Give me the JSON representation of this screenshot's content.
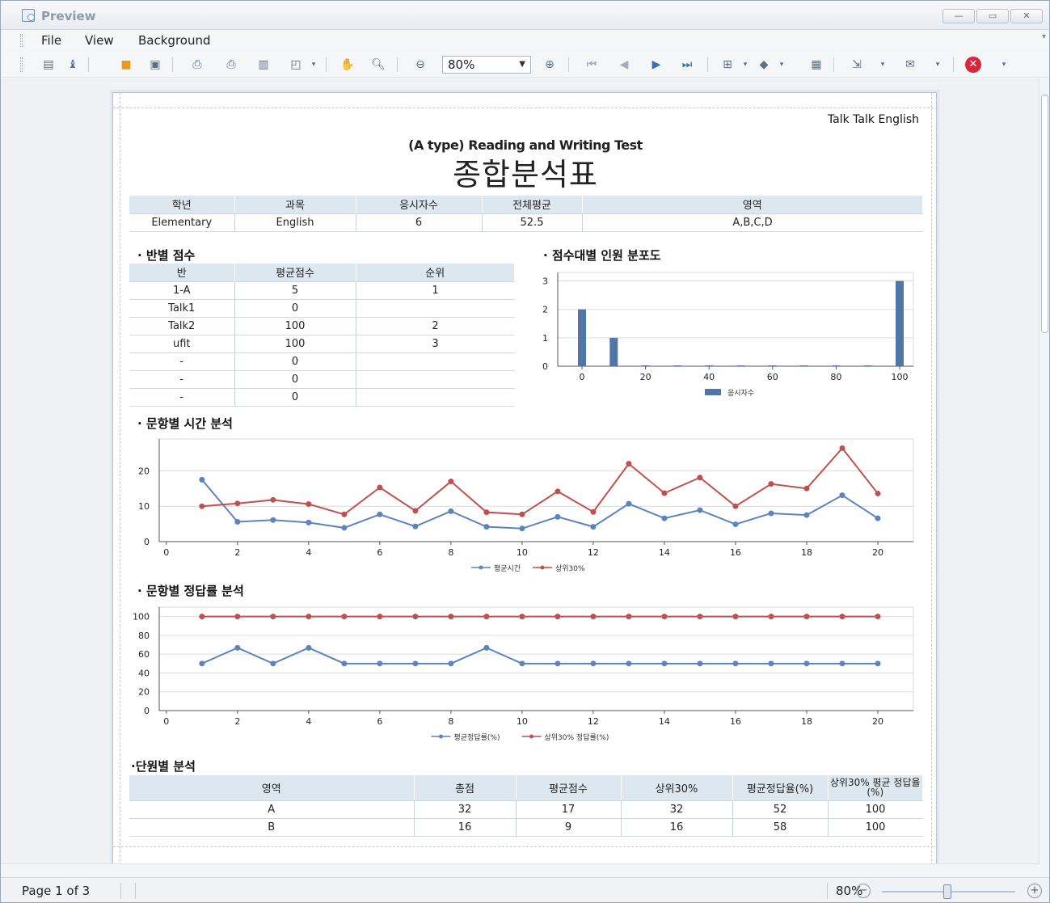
{
  "window": {
    "title": "Preview",
    "minimize": "—",
    "maximize": "▭",
    "close": "✕"
  },
  "menu": {
    "items": [
      "File",
      "View",
      "Background"
    ]
  },
  "toolbar": {
    "zoom": "80%"
  },
  "statusbar": {
    "page": "Page 1 of 3",
    "zoom": "80%",
    "zoom_out": "−",
    "zoom_in": "+"
  },
  "report": {
    "brand": "Talk Talk English",
    "subtitle": "(A type) Reading and Writing Test",
    "title": "종합분석표",
    "summary": {
      "headers": [
        "학년",
        "과목",
        "응시자수",
        "전체평균",
        "영역"
      ],
      "row": [
        "Elementary",
        "English",
        "6",
        "52.5",
        "A,B,C,D"
      ]
    },
    "class_scores": {
      "title": "· 반별 점수",
      "headers": [
        "반",
        "평균점수",
        "순위"
      ],
      "rows": [
        [
          "1-A",
          "5",
          "1"
        ],
        [
          "Talk1",
          "0",
          ""
        ],
        [
          "Talk2",
          "100",
          "2"
        ],
        [
          "ufit",
          "100",
          "3"
        ],
        [
          "-",
          "0",
          ""
        ],
        [
          "-",
          "0",
          ""
        ],
        [
          "-",
          "0",
          ""
        ]
      ]
    },
    "unit_analysis": {
      "title": "·단원별 분석",
      "headers": [
        "영역",
        "총점",
        "평균점수",
        "상위30%",
        "평균정답율(%)",
        "상위30% 평균 정답율(%)"
      ],
      "rows": [
        [
          "A",
          "32",
          "17",
          "32",
          "52",
          "100"
        ],
        [
          "B",
          "16",
          "9",
          "16",
          "58",
          "100"
        ]
      ]
    }
  },
  "chart_data": [
    {
      "type": "bar",
      "title": "· 점수대별 인원 분포도",
      "x": [
        0,
        10,
        20,
        30,
        40,
        50,
        60,
        70,
        80,
        90,
        100
      ],
      "xticks": [
        0,
        20,
        40,
        60,
        80,
        100
      ],
      "ylim": [
        0,
        3.3
      ],
      "yticks": [
        0,
        1,
        2,
        3
      ],
      "series": [
        {
          "name": "응시자수",
          "values": [
            2,
            1,
            0,
            0,
            0,
            0,
            0,
            0,
            0,
            0,
            3
          ],
          "color": "#4f76a6"
        }
      ],
      "legend": "bottom"
    },
    {
      "type": "line",
      "title": "· 문항별 시간 분석",
      "x": [
        1,
        2,
        3,
        4,
        5,
        6,
        7,
        8,
        9,
        10,
        11,
        12,
        13,
        14,
        15,
        16,
        17,
        18,
        19,
        20
      ],
      "xlim": [
        -0.2,
        21
      ],
      "xticks": [
        0,
        2,
        4,
        6,
        8,
        10,
        12,
        14,
        16,
        18,
        20
      ],
      "ylim": [
        0,
        29
      ],
      "yticks": [
        0,
        10,
        20
      ],
      "series": [
        {
          "name": "평균시간",
          "color": "#5b84bf",
          "values": [
            17.5,
            5.6,
            6.1,
            5.4,
            3.9,
            7.7,
            4.3,
            8.6,
            4.2,
            3.7,
            7.0,
            4.2,
            10.7,
            6.6,
            8.9,
            4.9,
            8.0,
            7.5,
            13.1,
            6.6
          ]
        },
        {
          "name": "상위30%",
          "color": "#c0504d",
          "values": [
            10.0,
            10.8,
            11.8,
            10.6,
            7.7,
            15.3,
            8.7,
            17.0,
            8.3,
            7.7,
            14.2,
            8.4,
            22.0,
            13.7,
            18.1,
            10.0,
            16.3,
            15.0,
            26.4,
            13.6
          ]
        }
      ],
      "legend": "bottom"
    },
    {
      "type": "line",
      "title": "· 문항별 정답률 분석",
      "x": [
        1,
        2,
        3,
        4,
        5,
        6,
        7,
        8,
        9,
        10,
        11,
        12,
        13,
        14,
        15,
        16,
        17,
        18,
        19,
        20
      ],
      "xlim": [
        -0.2,
        21
      ],
      "xticks": [
        0,
        2,
        4,
        6,
        8,
        10,
        12,
        14,
        16,
        18,
        20
      ],
      "ylim": [
        0,
        110
      ],
      "yticks": [
        0,
        20,
        40,
        60,
        80,
        100
      ],
      "series": [
        {
          "name": "평균정답률(%)",
          "color": "#5b84bf",
          "values": [
            50,
            66.7,
            50,
            66.7,
            50,
            50,
            50,
            50,
            66.7,
            50,
            50,
            50,
            50,
            50,
            50,
            50,
            50,
            50,
            50,
            50
          ]
        },
        {
          "name": "상위30% 정답률(%)",
          "color": "#c0504d",
          "values": [
            100,
            100,
            100,
            100,
            100,
            100,
            100,
            100,
            100,
            100,
            100,
            100,
            100,
            100,
            100,
            100,
            100,
            100,
            100,
            100
          ]
        }
      ],
      "legend": "bottom"
    }
  ]
}
